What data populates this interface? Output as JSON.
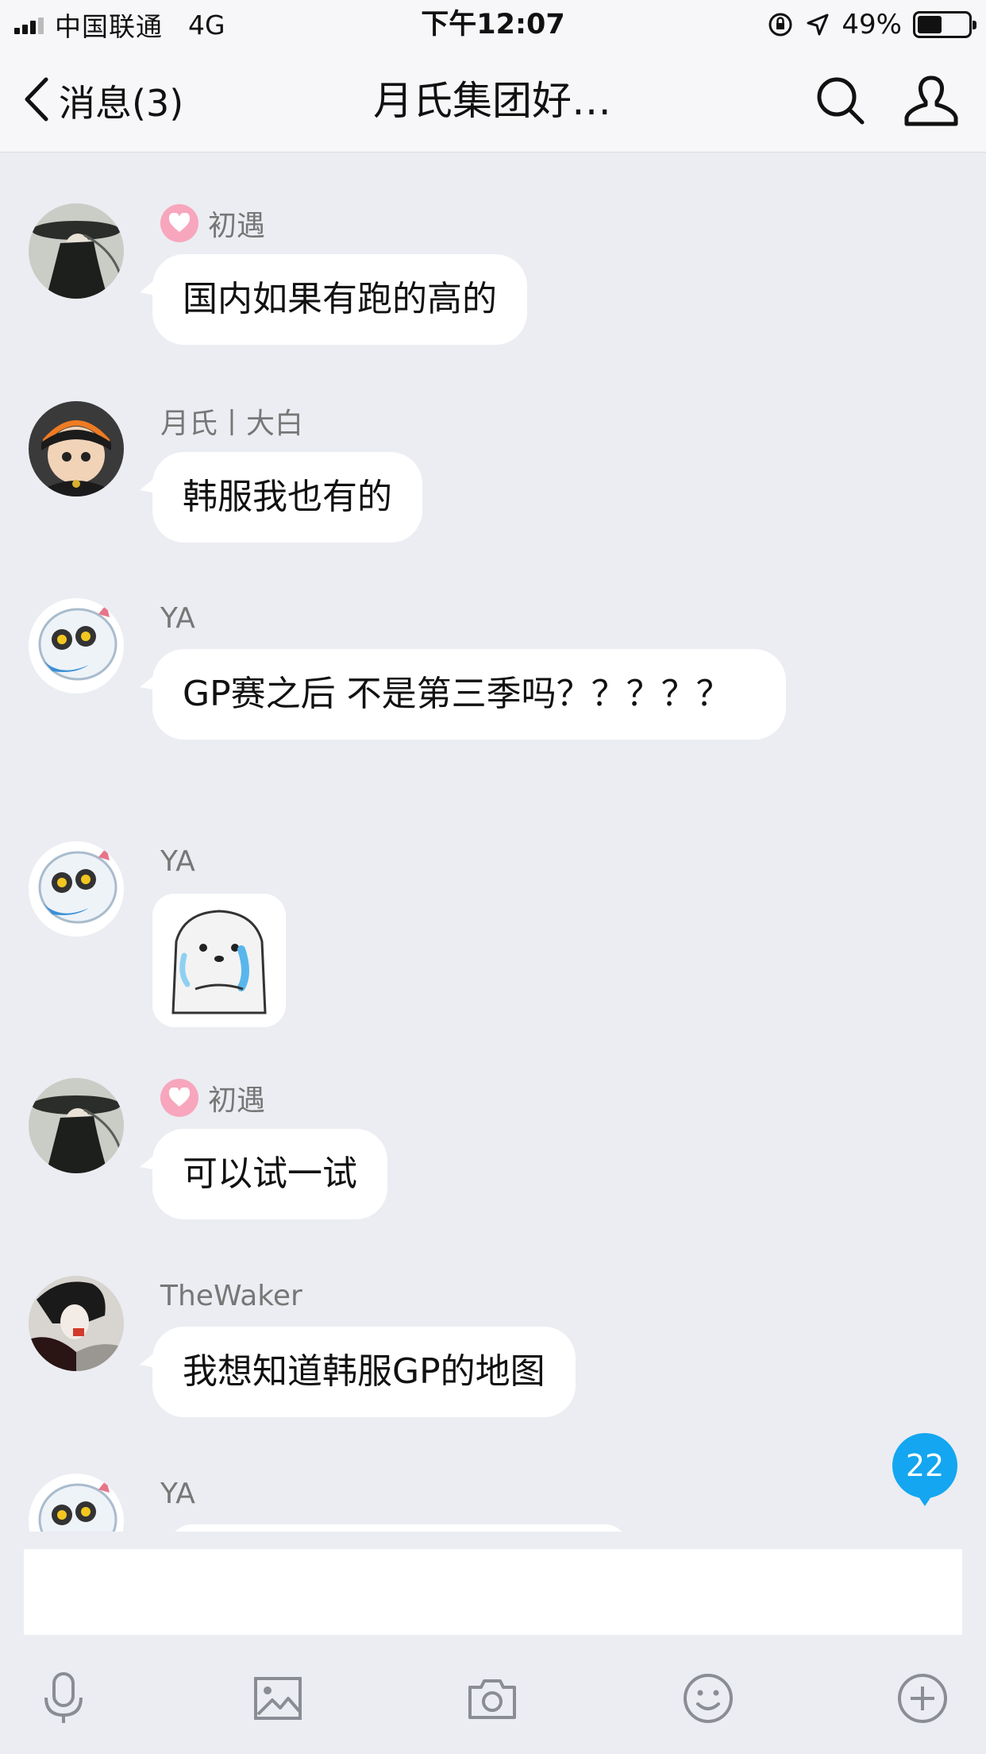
{
  "status_bar": {
    "carrier": "中国联通",
    "network": "4G",
    "time": "下午12:07",
    "battery_pct": "49%",
    "battery_level": 0.49
  },
  "nav": {
    "back_label": "消息(3)",
    "title": "月氏集团好…"
  },
  "messages": [
    {
      "sender": "初遇",
      "has_badge": true,
      "text": "国内如果有跑的高的"
    },
    {
      "sender": "月氏丨大白",
      "has_badge": false,
      "text": "韩服我也有的"
    },
    {
      "sender": "YA",
      "has_badge": false,
      "text": "GP赛之后  不是第三季吗？？？？？"
    },
    {
      "sender": "YA",
      "has_badge": false,
      "text": "",
      "sticker": "hamster-sticker"
    },
    {
      "sender": "初遇",
      "has_badge": true,
      "text": "可以试一试"
    },
    {
      "sender": "TheWaker",
      "has_badge": false,
      "text": "我想知道韩服GP的地图"
    },
    {
      "sender": "YA",
      "has_badge": false,
      "text": ""
    }
  ],
  "unread_count": "22",
  "input": {
    "value": "",
    "placeholder": ""
  },
  "toolbar": [
    "microphone-icon",
    "image-icon",
    "camera-icon",
    "emoji-icon",
    "plus-icon"
  ],
  "colors": {
    "accent": "#14a6f0",
    "background": "#ebedf2",
    "bubble": "#ffffff",
    "badge_pink": "#f7a6bd"
  }
}
